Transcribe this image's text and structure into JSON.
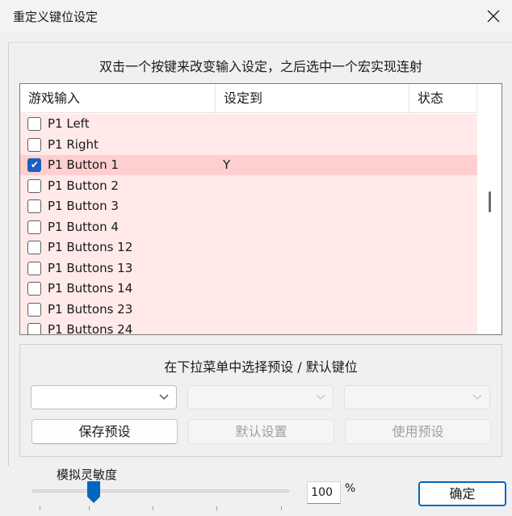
{
  "window": {
    "title": "重定义键位设定"
  },
  "instruction": "双击一个按键来改变输入设定，之后选中一个宏实现连射",
  "listview": {
    "columns": [
      "游戏输入",
      "设定到",
      "状态"
    ],
    "rows": [
      {
        "label": "P1 Left",
        "checked": false,
        "value": "",
        "selected": false
      },
      {
        "label": "P1 Right",
        "checked": false,
        "value": "",
        "selected": false
      },
      {
        "label": "P1 Button 1",
        "checked": true,
        "value": "Y",
        "selected": true
      },
      {
        "label": "P1 Button 2",
        "checked": false,
        "value": "",
        "selected": false
      },
      {
        "label": "P1 Button 3",
        "checked": false,
        "value": "",
        "selected": false
      },
      {
        "label": "P1 Button 4",
        "checked": false,
        "value": "",
        "selected": false
      },
      {
        "label": "P1 Buttons 12",
        "checked": false,
        "value": "",
        "selected": false
      },
      {
        "label": "P1 Buttons 13",
        "checked": false,
        "value": "",
        "selected": false
      },
      {
        "label": "P1 Buttons 14",
        "checked": false,
        "value": "",
        "selected": false
      },
      {
        "label": "P1 Buttons 23",
        "checked": false,
        "value": "",
        "selected": false
      },
      {
        "label": "P1 Buttons 24",
        "checked": false,
        "value": "",
        "selected": false
      }
    ]
  },
  "presets": {
    "title": "在下拉菜单中选择预设 / 默认键位",
    "save_label": "保存预设",
    "default_label": "默认设置",
    "use_label": "使用预设"
  },
  "sensitivity": {
    "label": "模拟灵敏度",
    "value": "100",
    "unit": "%",
    "slider_fraction": 0.24
  },
  "ok_label": "确定",
  "colors": {
    "row_background": "#ffe9e9",
    "row_selected": "#ffcfcf",
    "checkbox_checked": "#1b5fbf",
    "accent": "#0067c0"
  }
}
